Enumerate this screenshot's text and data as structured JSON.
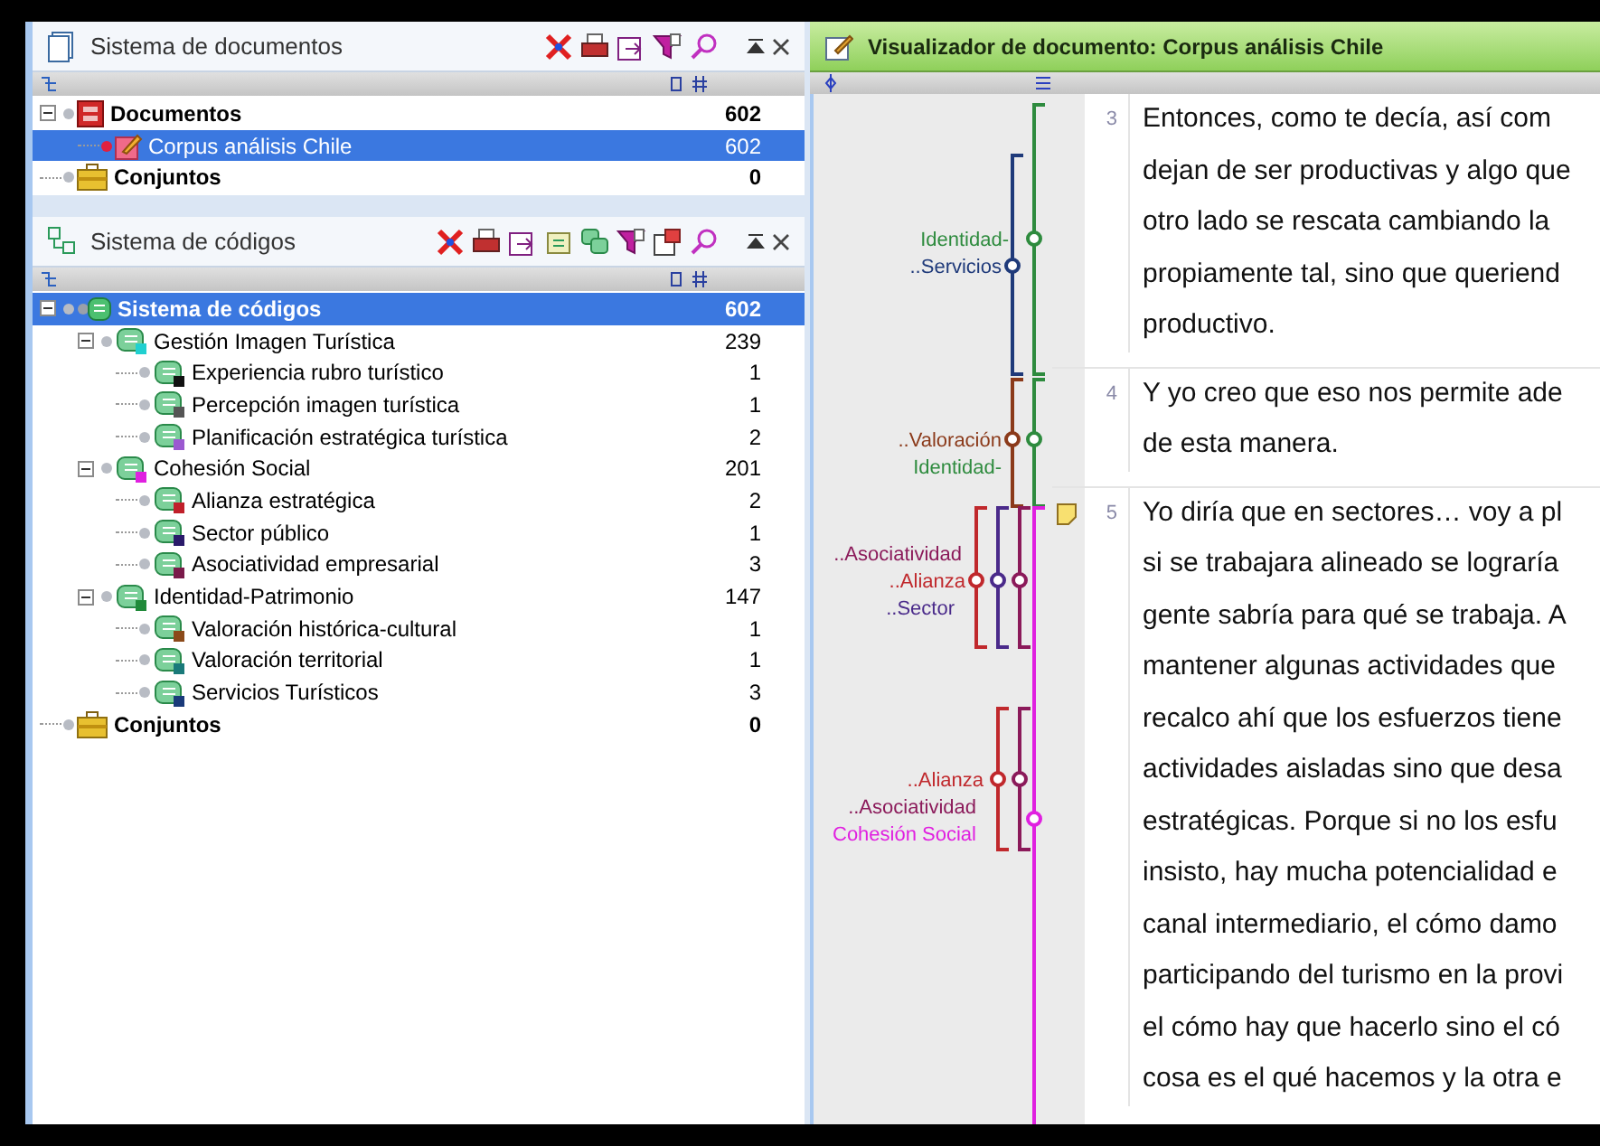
{
  "document_system": {
    "title": "Sistema de documentos",
    "items": [
      {
        "kind": "folder",
        "label": "Documentos",
        "count": "602",
        "selected": false,
        "expanded": true,
        "children": [
          {
            "kind": "document",
            "label": "Corpus análisis Chile",
            "count": "602",
            "selected": true
          }
        ]
      },
      {
        "kind": "sets",
        "label": "Conjuntos",
        "count": "0",
        "selected": false
      }
    ]
  },
  "code_system": {
    "title": "Sistema de códigos",
    "items": [
      {
        "kind": "root",
        "label": "Sistema de códigos",
        "count": "602",
        "selected": true,
        "expanded": true,
        "children": [
          {
            "kind": "code",
            "label": "Gestión Imagen Turística",
            "count": "239",
            "color": "#20d0d0",
            "selected": false,
            "expanded": true,
            "children": [
              {
                "kind": "code",
                "label": "Experiencia rubro turístico",
                "count": "1",
                "color": "#111111",
                "selected": false
              },
              {
                "kind": "code",
                "label": "Percepción imagen turística",
                "count": "1",
                "color": "#555555",
                "selected": false
              },
              {
                "kind": "code",
                "label": "Planificación estratégica turística",
                "count": "2",
                "color": "#9b59d0",
                "selected": false
              }
            ]
          },
          {
            "kind": "code",
            "label": "Cohesión Social",
            "count": "201",
            "color": "#e020e0",
            "selected": false,
            "expanded": true,
            "children": [
              {
                "kind": "code",
                "label": "Alianza estratégica",
                "count": "2",
                "color": "#c0202a",
                "selected": false
              },
              {
                "kind": "code",
                "label": "Sector público",
                "count": "1",
                "color": "#2a1a6a",
                "selected": false
              },
              {
                "kind": "code",
                "label": "Asociatividad empresarial",
                "count": "3",
                "color": "#7a1a4a",
                "selected": false
              }
            ]
          },
          {
            "kind": "code",
            "label": "Identidad-Patrimonio",
            "count": "147",
            "color": "#208a3a",
            "selected": false,
            "expanded": true,
            "children": [
              {
                "kind": "code",
                "label": "Valoración histórica-cultural",
                "count": "1",
                "color": "#8b4a1a",
                "selected": false
              },
              {
                "kind": "code",
                "label": "Valoración territorial",
                "count": "1",
                "color": "#1a7a7a",
                "selected": false
              },
              {
                "kind": "code",
                "label": "Servicios Turísticos",
                "count": "3",
                "color": "#1a3a7a",
                "selected": false
              }
            ]
          }
        ]
      },
      {
        "kind": "sets",
        "label": "Conjuntos",
        "count": "0",
        "selected": false
      }
    ]
  },
  "document_browser": {
    "title": "Visualizador de documento: Corpus análisis Chile",
    "coding_stripes": [
      {
        "label": "Identidad-",
        "color": "#2e8b3e"
      },
      {
        "label": "..Servicios",
        "color": "#1f3a7a"
      },
      {
        "label": "..Valoración",
        "color": "#8b3a1a"
      },
      {
        "label": "Identidad-",
        "color": "#2e8b3e"
      },
      {
        "label": "..Asociatividad",
        "color": "#8b1a5a"
      },
      {
        "label": "..Alianza",
        "color": "#c0282c"
      },
      {
        "label": "..Sector",
        "color": "#4a2a8a"
      },
      {
        "label": "..Alianza",
        "color": "#c0282c"
      },
      {
        "label": "..Asociatividad",
        "color": "#8b1a5a"
      },
      {
        "label": "Cohesión Social",
        "color": "#e020e0"
      }
    ],
    "paragraphs": [
      {
        "number": "3",
        "memo": false,
        "lines": [
          "Entonces, como te decía, así com",
          "dejan de ser productivas y algo que",
          "otro lado se rescata cambiando la",
          "propiamente tal, sino que queriend",
          "productivo."
        ]
      },
      {
        "number": "4",
        "memo": false,
        "lines": [
          "Y yo creo que eso nos permite ade",
          "de esta manera."
        ]
      },
      {
        "number": "5",
        "memo": true,
        "lines": [
          "Yo diría que en sectores… voy a pl",
          "si se trabajara alineado se lograría",
          "gente sabría para qué se trabaja. A",
          "mantener algunas actividades que",
          "recalco ahí que los esfuerzos tiene",
          "actividades aisladas sino que desa",
          "estratégicas. Porque si no los esfu",
          "insisto, hay mucha potencialidad e",
          "canal intermediario, el cómo damo",
          "participando del turismo en la provi",
          "el cómo hay que hacerlo sino el có",
          "cosa es el qué hacemos y la otra e"
        ]
      }
    ]
  }
}
